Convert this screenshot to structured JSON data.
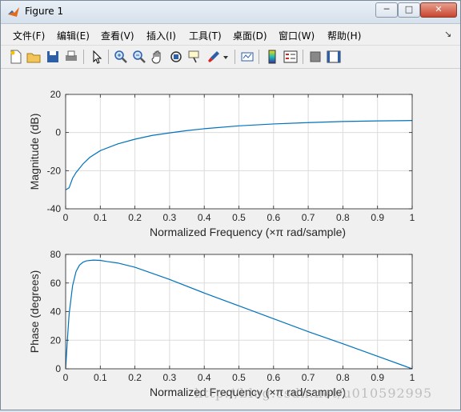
{
  "window": {
    "title": "Figure 1",
    "min_glyph": "─",
    "max_glyph": "□",
    "close_glyph": "✕"
  },
  "menubar": {
    "items": [
      {
        "label": "文件(F)"
      },
      {
        "label": "编辑(E)"
      },
      {
        "label": "查看(V)"
      },
      {
        "label": "插入(I)"
      },
      {
        "label": "工具(T)"
      },
      {
        "label": "桌面(D)"
      },
      {
        "label": "窗口(W)"
      },
      {
        "label": "帮助(H)"
      }
    ],
    "overflow_glyph": "↘"
  },
  "toolbar": {
    "icons": [
      "new-figure-icon",
      "open-file-icon",
      "save-icon",
      "print-icon",
      "pointer-icon",
      "zoom-in-icon",
      "zoom-out-icon",
      "pan-icon",
      "rotate-3d-icon",
      "data-cursor-icon",
      "brush-icon",
      "brush-dropdown-icon",
      "link-plot-icon",
      "insert-colorbar-icon",
      "insert-legend-icon",
      "hide-plot-tools-icon",
      "show-plot-tools-icon"
    ]
  },
  "colors": {
    "line": "#0072bd",
    "grid": "#dcdcdc",
    "axes": "#262626"
  },
  "chart_data": [
    {
      "type": "line",
      "xlabel": "Normalized Frequency  (×π rad/sample)",
      "ylabel": "Magnitude (dB)",
      "xlim": [
        0,
        1
      ],
      "ylim": [
        -40,
        20
      ],
      "xticks": [
        0,
        0.1,
        0.2,
        0.3,
        0.4,
        0.5,
        0.6,
        0.7,
        0.8,
        0.9,
        1
      ],
      "xtick_labels": [
        "0",
        "0.1",
        "0.2",
        "0.3",
        "0.4",
        "0.5",
        "0.6",
        "0.7",
        "0.8",
        "0.9",
        "1"
      ],
      "yticks": [
        -40,
        -20,
        0,
        20
      ],
      "ytick_labels": [
        "-40",
        "-20",
        "0",
        "20"
      ],
      "grid": true,
      "series": [
        {
          "x": [
            0.001,
            0.01,
            0.02,
            0.03,
            0.05,
            0.07,
            0.1,
            0.15,
            0.2,
            0.25,
            0.3,
            0.35,
            0.4,
            0.5,
            0.6,
            0.7,
            0.8,
            0.9,
            1.0
          ],
          "values": [
            -30,
            -29,
            -24,
            -21,
            -16.5,
            -13,
            -9.5,
            -6,
            -3.5,
            -1.5,
            -0.2,
            1,
            2,
            3.5,
            4.5,
            5.2,
            5.8,
            6.1,
            6.3
          ]
        }
      ]
    },
    {
      "type": "line",
      "xlabel": "Normalized Frequency  (×π rad/sample)",
      "ylabel": "Phase (degrees)",
      "xlim": [
        0,
        1
      ],
      "ylim": [
        0,
        80
      ],
      "xticks": [
        0,
        0.1,
        0.2,
        0.3,
        0.4,
        0.5,
        0.6,
        0.7,
        0.8,
        0.9,
        1
      ],
      "xtick_labels": [
        "0",
        "0.1",
        "0.2",
        "0.3",
        "0.4",
        "0.5",
        "0.6",
        "0.7",
        "0.8",
        "0.9",
        "1"
      ],
      "yticks": [
        0,
        20,
        40,
        60,
        80
      ],
      "ytick_labels": [
        "0",
        "20",
        "40",
        "60",
        "80"
      ],
      "grid": true,
      "series": [
        {
          "x": [
            0,
            0.005,
            0.01,
            0.02,
            0.03,
            0.04,
            0.05,
            0.06,
            0.08,
            0.1,
            0.12,
            0.15,
            0.2,
            0.3,
            0.4,
            0.5,
            0.6,
            0.7,
            0.8,
            0.9,
            1.0
          ],
          "values": [
            0,
            20,
            38,
            58,
            68,
            72.5,
            74.5,
            75.5,
            76,
            75.8,
            75,
            74,
            71,
            62.5,
            53,
            44,
            35,
            26,
            17.5,
            8.8,
            0
          ]
        }
      ]
    }
  ],
  "watermark": "http://blog.csdn.net/u010592995"
}
